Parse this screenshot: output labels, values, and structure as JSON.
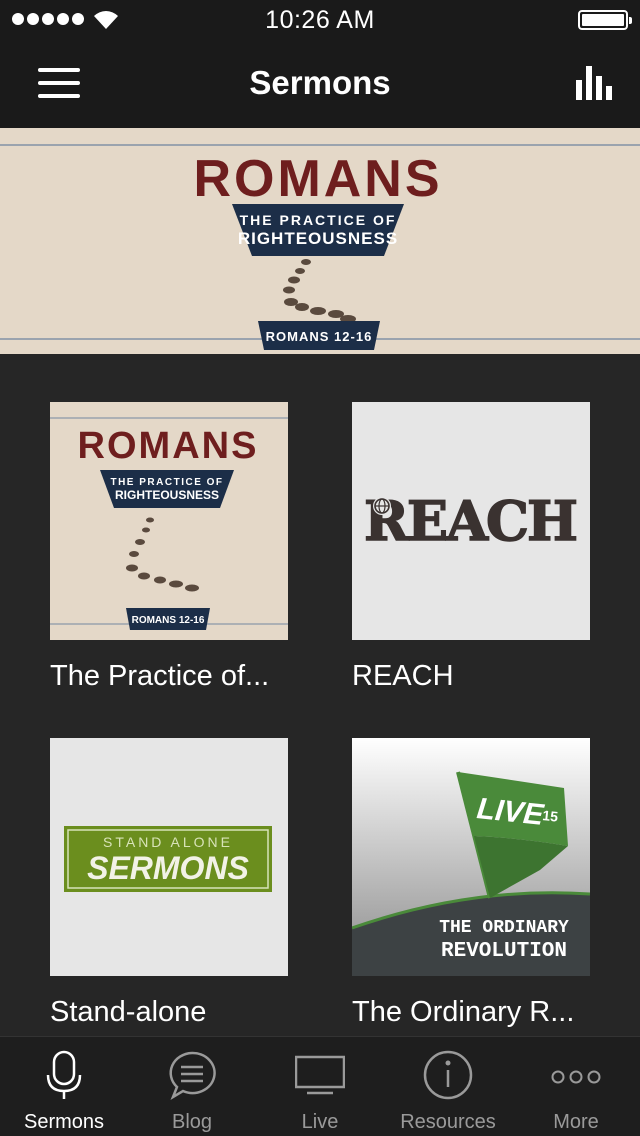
{
  "status_bar": {
    "time": "10:26 AM"
  },
  "nav": {
    "title": "Sermons"
  },
  "hero": {
    "title": "ROMANS",
    "subtitle_line1": "THE PRACTICE OF",
    "subtitle_line2": "RIGHTEOUSNESS",
    "reference": "ROMANS 12-16"
  },
  "series": [
    {
      "title": "The Practice of...",
      "art": {
        "title": "ROMANS",
        "subtitle_line1": "THE PRACTICE OF",
        "subtitle_line2": "RIGHTEOUSNESS",
        "reference": "ROMANS 12-16"
      }
    },
    {
      "title": "REACH",
      "art": {
        "title": "REACH"
      }
    },
    {
      "title": "Stand-alone",
      "art": {
        "line1": "STAND ALONE",
        "line2": "SERMONS"
      }
    },
    {
      "title": "The Ordinary R...",
      "art": {
        "flag": "LIVE",
        "flag_small": "15",
        "line1": "THE ORDINARY",
        "line2": "REVOLUTION"
      }
    }
  ],
  "tabs": [
    {
      "label": "Sermons",
      "icon": "microphone-icon",
      "active": true
    },
    {
      "label": "Blog",
      "icon": "chat-bubble-icon",
      "active": false
    },
    {
      "label": "Live",
      "icon": "tv-icon",
      "active": false
    },
    {
      "label": "Resources",
      "icon": "info-icon",
      "active": false
    },
    {
      "label": "More",
      "icon": "more-dots-icon",
      "active": false
    }
  ],
  "colors": {
    "background": "#262626",
    "bar": "#1a1a1a",
    "romans_red": "#6e1e1e",
    "romans_navy": "#1c2e48",
    "romans_paper": "#e4d8c8",
    "reach_bg": "#e6e6e6",
    "reach_text": "#3a3230",
    "stand_alone_green": "#6b8e1e",
    "live_green": "#4a8a3a",
    "tab_active": "#ffffff",
    "tab_inactive": "#9a9a9a"
  }
}
